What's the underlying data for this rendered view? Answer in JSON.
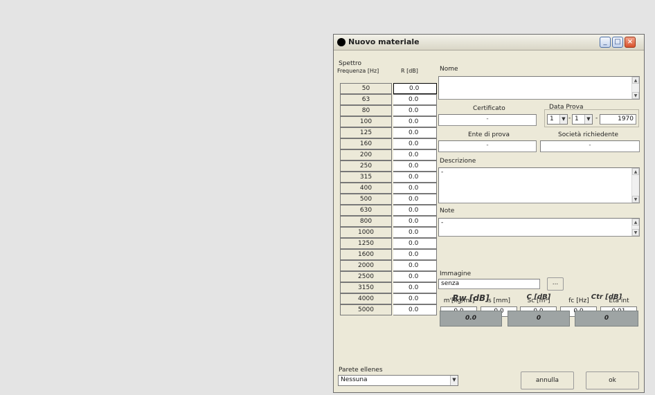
{
  "window": {
    "title": "Nuovo materiale",
    "minimize_icon": "minimize-icon",
    "maximize_icon": "maximize-icon",
    "close_icon": "close-icon"
  },
  "spectrum": {
    "group_label": "Spettro",
    "col_freq": "Frequenza [Hz]",
    "col_r": "R [dB]",
    "rows": [
      {
        "f": "50",
        "r": "0.0"
      },
      {
        "f": "63",
        "r": "0.0"
      },
      {
        "f": "80",
        "r": "0.0"
      },
      {
        "f": "100",
        "r": "0.0"
      },
      {
        "f": "125",
        "r": "0.0"
      },
      {
        "f": "160",
        "r": "0.0"
      },
      {
        "f": "200",
        "r": "0.0"
      },
      {
        "f": "250",
        "r": "0.0"
      },
      {
        "f": "315",
        "r": "0.0"
      },
      {
        "f": "400",
        "r": "0.0"
      },
      {
        "f": "500",
        "r": "0.0"
      },
      {
        "f": "630",
        "r": "0.0"
      },
      {
        "f": "800",
        "r": "0.0"
      },
      {
        "f": "1000",
        "r": "0.0"
      },
      {
        "f": "1250",
        "r": "0.0"
      },
      {
        "f": "1600",
        "r": "0.0"
      },
      {
        "f": "2000",
        "r": "0.0"
      },
      {
        "f": "2500",
        "r": "0.0"
      },
      {
        "f": "3150",
        "r": "0.0"
      },
      {
        "f": "4000",
        "r": "0.0"
      },
      {
        "f": "5000",
        "r": "0.0"
      }
    ]
  },
  "form": {
    "nome_label": "Nome",
    "nome_value": "",
    "certificato_label": "Certificato",
    "certificato_value": "-",
    "data_prova_label": "Data Prova",
    "day": "1",
    "month": "1",
    "year": "1970",
    "ente_label": "Ente di prova",
    "ente_value": "-",
    "societa_label": "Società richiedente",
    "societa_value": "-",
    "descrizione_label": "Descrizione",
    "descrizione_value": "-",
    "note_label": "Note",
    "note_value": "-",
    "immagine_label": "Immagine",
    "immagine_value": "senza",
    "browse_label": "..."
  },
  "params": [
    {
      "label": "m'[kg/m²]",
      "value": "0.0"
    },
    {
      "label": "s [mm]",
      "value": "0.0"
    },
    {
      "label": "Sc [m²]",
      "value": "0.0"
    },
    {
      "label": "fc [Hz]",
      "value": "0.0"
    },
    {
      "label": "Eta int",
      "value": "0.01"
    }
  ],
  "results": [
    {
      "label": "Rw [dB]",
      "value": "0.0"
    },
    {
      "label": "C [dB]",
      "value": "0"
    },
    {
      "label": "Ctr [dB]",
      "value": "0"
    }
  ],
  "bottom": {
    "parete_label": "Parete ellenes",
    "parete_value": "Nessuna",
    "annulla_label": "annulla",
    "ok_label": "ok"
  }
}
